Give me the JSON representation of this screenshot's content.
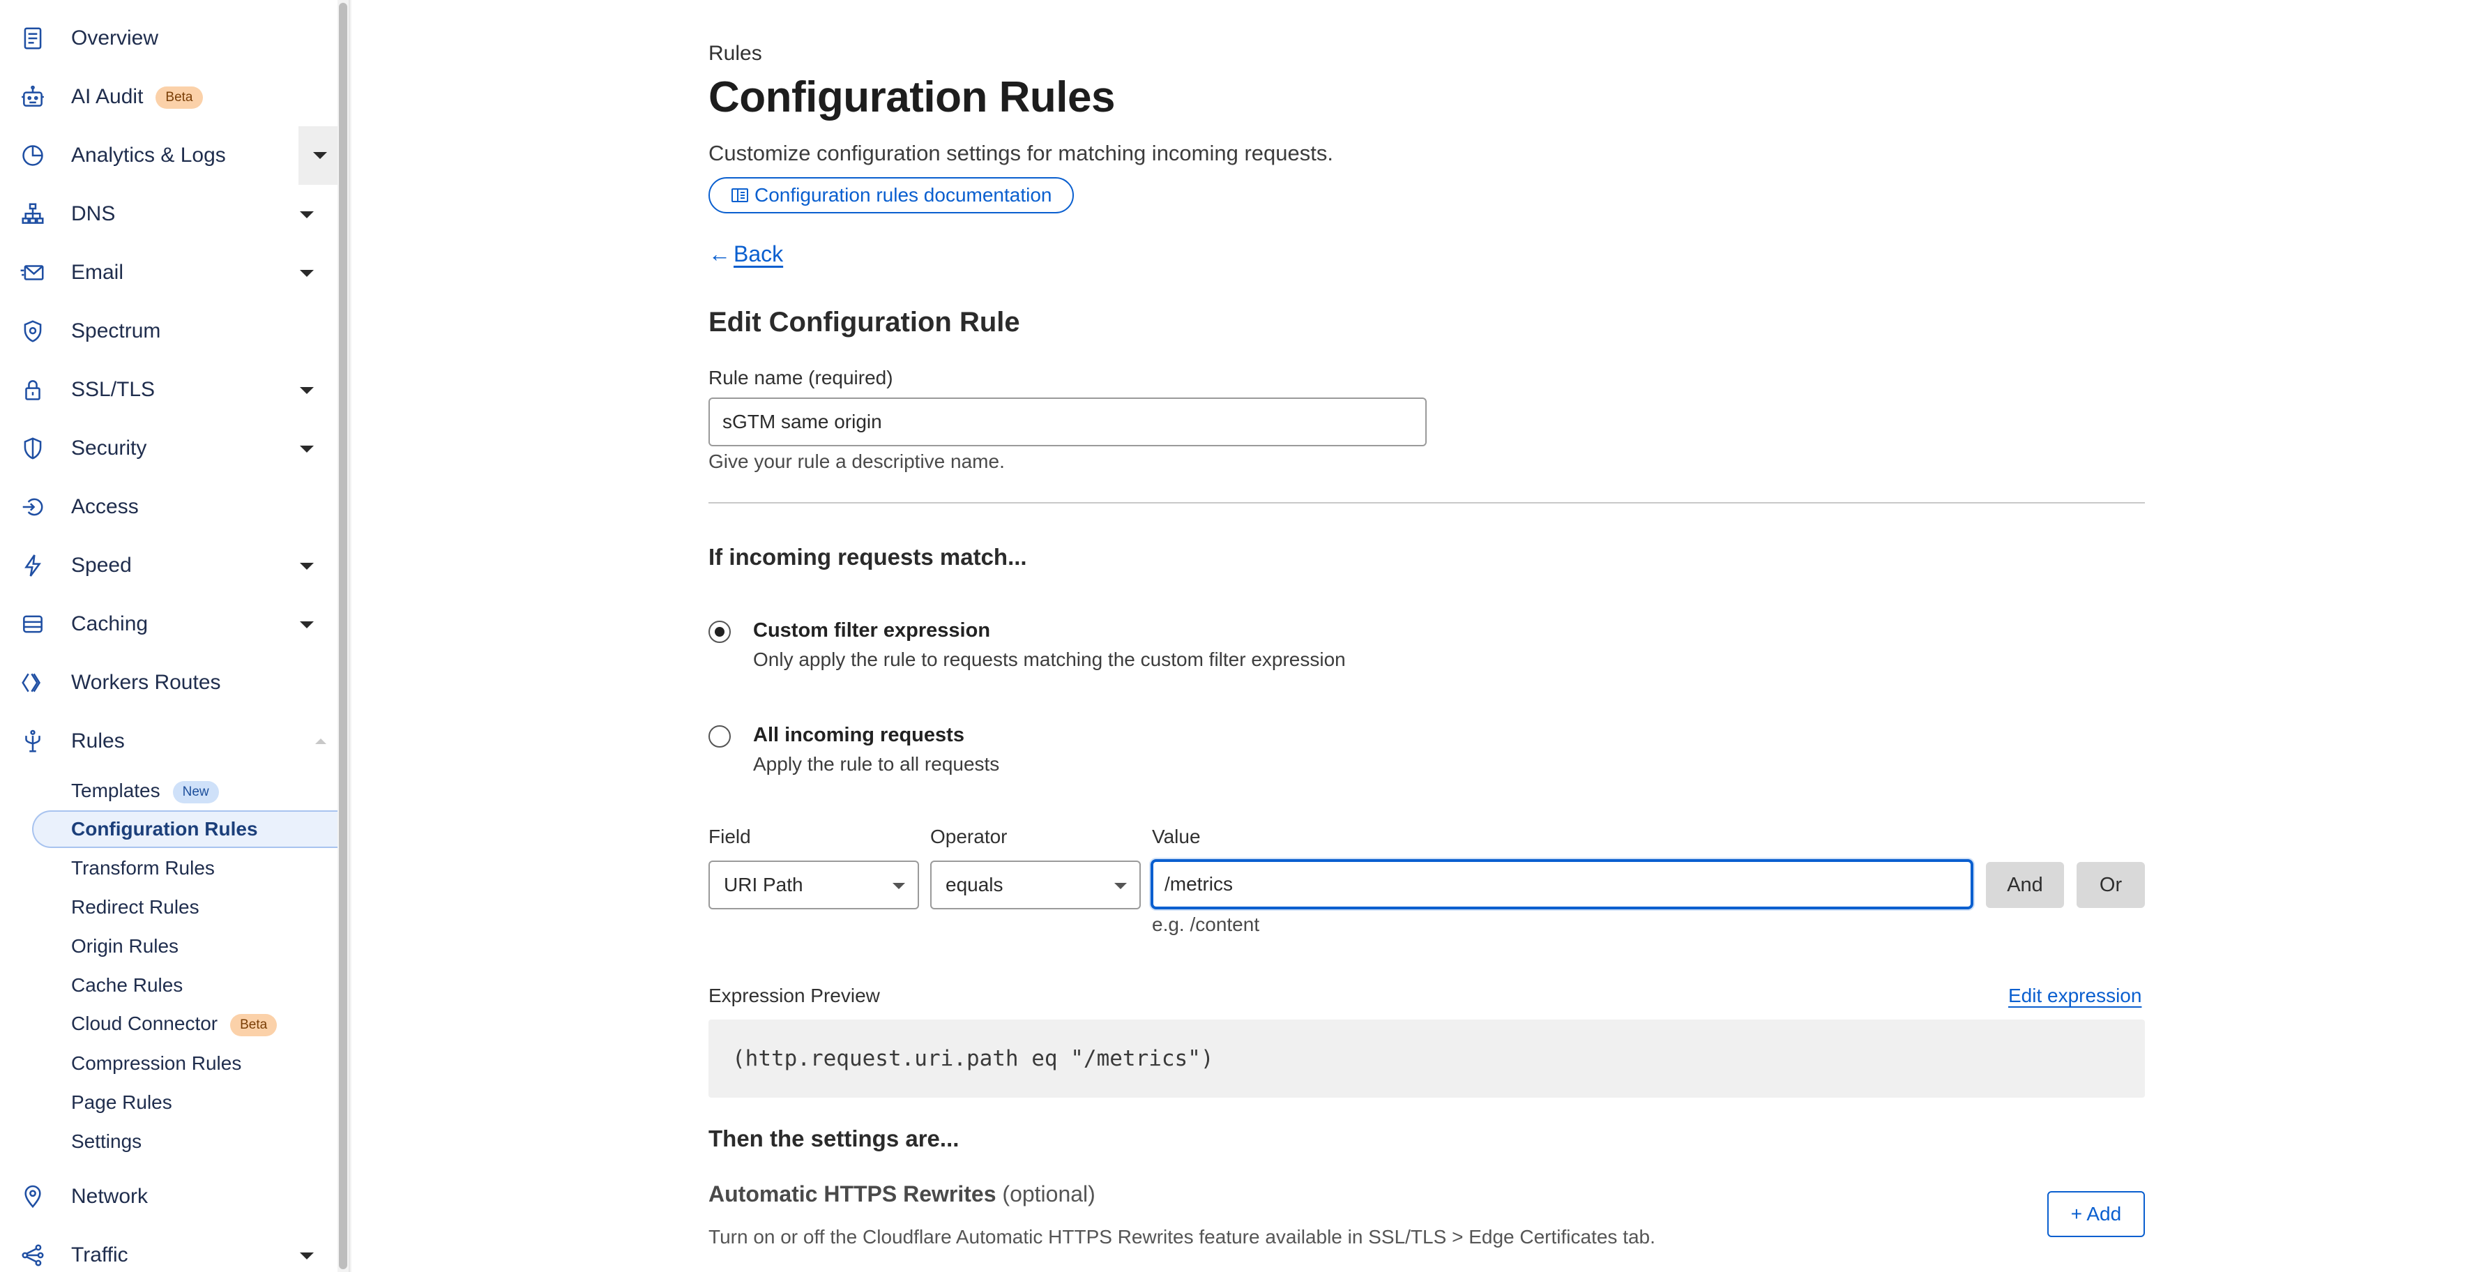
{
  "sidebar": {
    "items": [
      {
        "label": "Overview",
        "icon": "document-icon"
      },
      {
        "label": "AI Audit",
        "icon": "robot-icon",
        "badge": "Beta"
      },
      {
        "label": "Analytics & Logs",
        "icon": "pie-chart-icon"
      },
      {
        "label": "DNS",
        "icon": "network-tree-icon"
      },
      {
        "label": "Email",
        "icon": "email-icon"
      },
      {
        "label": "Spectrum",
        "icon": "shield-gear-icon"
      },
      {
        "label": "SSL/TLS",
        "icon": "lock-icon"
      },
      {
        "label": "Security",
        "icon": "shield-icon"
      },
      {
        "label": "Access",
        "icon": "access-icon"
      },
      {
        "label": "Speed",
        "icon": "bolt-icon"
      },
      {
        "label": "Caching",
        "icon": "server-icon"
      },
      {
        "label": "Workers Routes",
        "icon": "workers-icon"
      },
      {
        "label": "Rules",
        "icon": "fork-icon"
      },
      {
        "label": "Network",
        "icon": "location-pin-icon"
      },
      {
        "label": "Traffic",
        "icon": "traffic-icon"
      }
    ],
    "rules_subitems": [
      {
        "label": "Templates",
        "badge": "New"
      },
      {
        "label": "Configuration Rules",
        "active": true
      },
      {
        "label": "Transform Rules"
      },
      {
        "label": "Redirect Rules"
      },
      {
        "label": "Origin Rules"
      },
      {
        "label": "Cache Rules"
      },
      {
        "label": "Cloud Connector",
        "badge": "Beta"
      },
      {
        "label": "Compression Rules"
      },
      {
        "label": "Page Rules"
      },
      {
        "label": "Settings"
      }
    ]
  },
  "header": {
    "breadcrumb": "Rules",
    "title": "Configuration Rules",
    "description": "Customize configuration settings for matching incoming requests.",
    "doc_link": "Configuration rules documentation",
    "back": "Back",
    "back_arrow": "←"
  },
  "form": {
    "section_title": "Edit Configuration Rule",
    "rule_name_label": "Rule name (required)",
    "rule_name_value": "sGTM same origin",
    "rule_name_help": "Give your rule a descriptive name.",
    "match_heading": "If incoming requests match...",
    "option_custom_title": "Custom filter expression",
    "option_custom_desc": "Only apply the rule to requests matching the custom filter expression",
    "option_all_title": "All incoming requests",
    "option_all_desc": "Apply the rule to all requests",
    "selected_option": "custom",
    "field_label": "Field",
    "field_value": "URI Path",
    "operator_label": "Operator",
    "operator_value": "equals",
    "value_label": "Value",
    "value_value": "/metrics",
    "value_hint": "e.g. /content",
    "and_button": "And",
    "or_button": "Or",
    "expr_label": "Expression Preview",
    "edit_expr": "Edit expression",
    "expression": "(http.request.uri.path eq \"/metrics\")",
    "then_heading": "Then the settings are...",
    "setting_title": "Automatic HTTPS Rewrites",
    "setting_optional": "(optional)",
    "setting_desc": "Turn on or off the Cloudflare Automatic HTTPS Rewrites feature available in SSL/TLS > Edge Certificates tab.",
    "add_button": "+ Add"
  },
  "colors": {
    "accent": "#0a5fcf",
    "nav_text": "#1f2d4d",
    "beta_badge": "#fbd1a9",
    "new_badge": "#cfe1f9"
  }
}
